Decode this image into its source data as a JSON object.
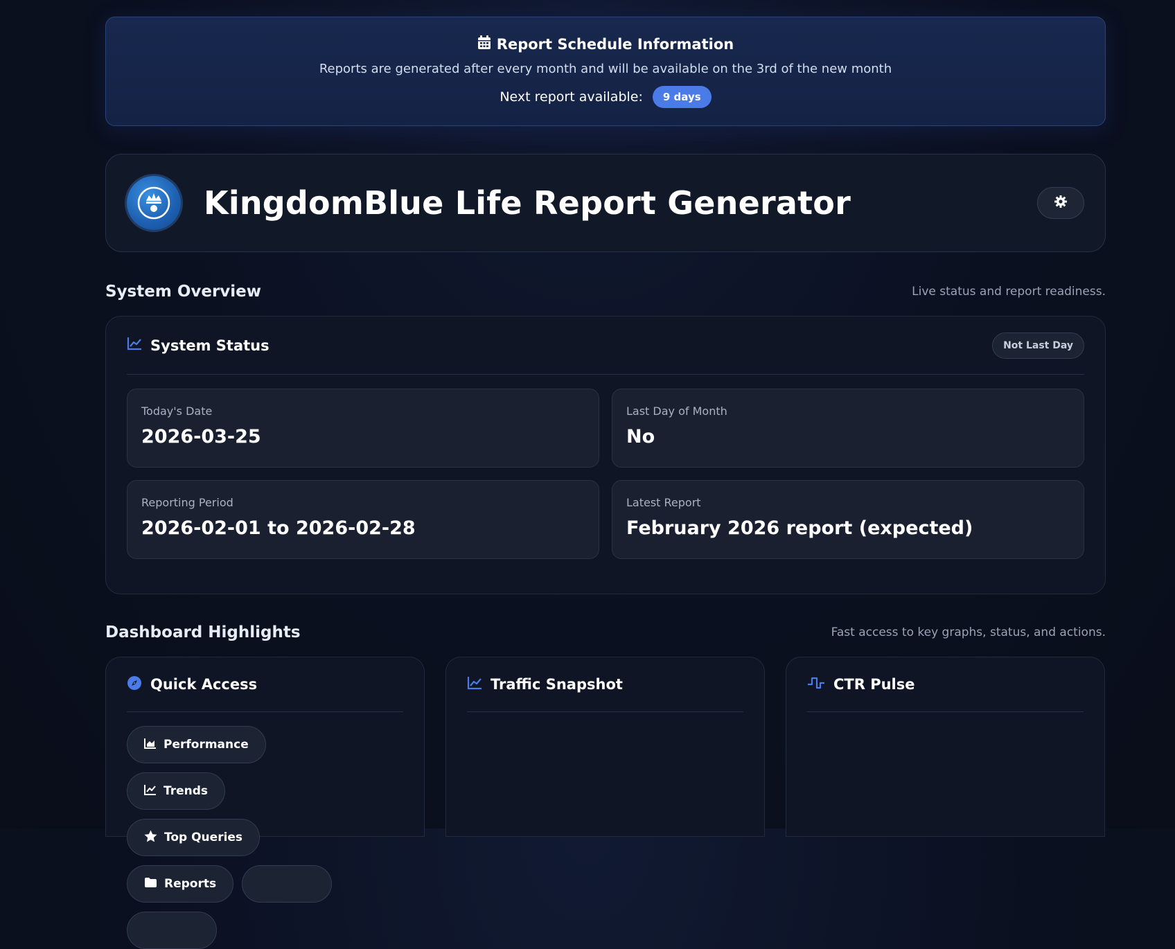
{
  "schedule": {
    "title": "Report Schedule Information",
    "description": "Reports are generated after every month and will be available on the 3rd of the new month",
    "next_label": "Next report available:",
    "next_value": "9 days"
  },
  "header": {
    "title": "KingdomBlue Life Report Generator",
    "settings_icon": "gear-icon"
  },
  "overview": {
    "title": "System Overview",
    "subtitle": "Live status and report readiness.",
    "panel_title": "System Status",
    "badge": "Not Last Day",
    "stats": [
      {
        "label": "Today's Date",
        "value": "2026-03-25"
      },
      {
        "label": "Last Day of Month",
        "value": "No"
      },
      {
        "label": "Reporting Period",
        "value": "2026-02-01 to 2026-02-28"
      },
      {
        "label": "Latest Report",
        "value": "February 2026 report (expected)"
      }
    ]
  },
  "highlights": {
    "title": "Dashboard Highlights",
    "subtitle": "Fast access to key graphs, status, and actions.",
    "quick_access": {
      "title": "Quick Access",
      "buttons": [
        {
          "label": "Performance",
          "icon": "area-chart-icon"
        },
        {
          "label": "Trends",
          "icon": "line-chart-icon"
        },
        {
          "label": "Top Queries",
          "icon": "star-icon"
        },
        {
          "label": "Reports",
          "icon": "folder-icon"
        }
      ]
    },
    "traffic": {
      "title": "Traffic Snapshot"
    },
    "ctr": {
      "title": "CTR Pulse"
    }
  },
  "colors": {
    "accent": "#4a7be6",
    "background": "#0b1020",
    "card": "#0f1524"
  }
}
